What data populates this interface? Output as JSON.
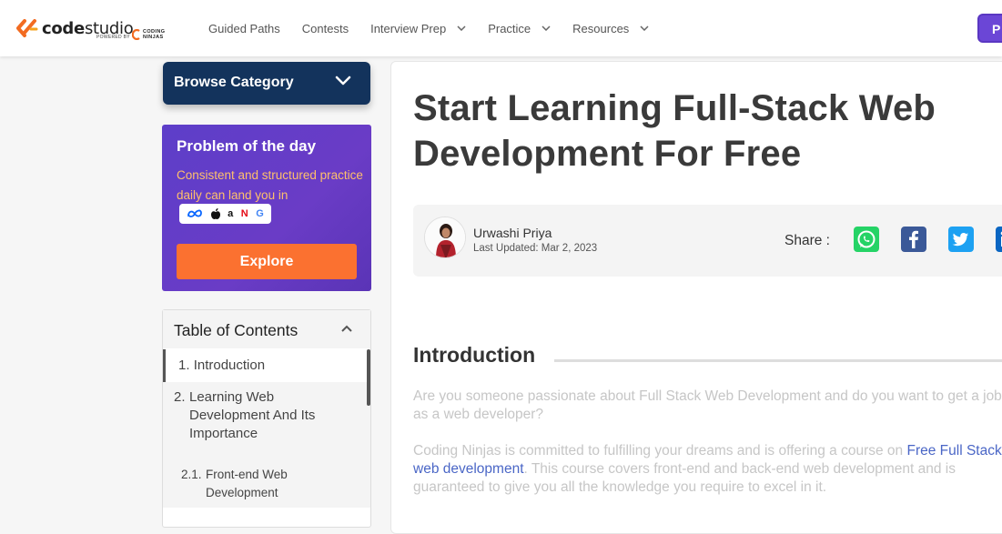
{
  "brand": {
    "name_bold": "code",
    "name_light": "studio",
    "powered_by": "POWERED BY",
    "partner_line1": "CODING",
    "partner_line2": "NINJAS"
  },
  "nav": {
    "items": [
      {
        "label": "Guided Paths",
        "has_dropdown": false
      },
      {
        "label": "Contests",
        "has_dropdown": false
      },
      {
        "label": "Interview Prep",
        "has_dropdown": true
      },
      {
        "label": "Practice",
        "has_dropdown": true
      },
      {
        "label": "Resources",
        "has_dropdown": true
      }
    ],
    "cta_label": "P"
  },
  "sidebar": {
    "browse_label": "Browse Category",
    "potd": {
      "title": "Problem of the day",
      "description": "Consistent and structured practice daily can land you in",
      "company_logos": [
        "meta",
        "apple",
        "amazon",
        "netflix",
        "google"
      ],
      "explore_label": "Explore"
    },
    "toc": {
      "title": "Table of Contents",
      "items": [
        {
          "num": "1.",
          "label": "Introduction",
          "active": true
        },
        {
          "num": "2.",
          "label": "Learning Web Development And Its Importance",
          "active": false
        },
        {
          "num": "2.1.",
          "label": "Front-end Web Development",
          "active": false
        }
      ]
    }
  },
  "article": {
    "title": "Start Learning Full-Stack Web Development For Free",
    "author": "Urwashi Priya",
    "last_updated": "Last Updated: Mar 2, 2023",
    "share_label": "Share :",
    "share_targets": [
      "whatsapp",
      "facebook",
      "twitter",
      "linkedin"
    ],
    "intro_heading": "Introduction",
    "para1": "Are you someone passionate about Full Stack Web Development and do you want to get a job as a web developer?",
    "para2_before": "Coding Ninjas is committed to fulfilling your dreams and is offering a course on ",
    "para2_link": "Free Full Stack web development",
    "para2_after": ". This course covers front-end and back-end web development and is guaranteed to give you all the knowledge you require to excel in it."
  },
  "colors": {
    "browse_bg": "#13335c",
    "potd_bg": "#5d3ec9",
    "potd_text": "#ffc06b",
    "explore_bg": "#fb7130",
    "cta_bg": "#6b46d6",
    "link": "#4a66c6"
  }
}
